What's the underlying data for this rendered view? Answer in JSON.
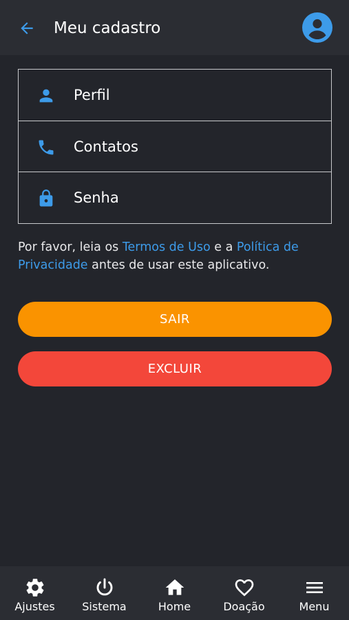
{
  "header": {
    "title": "Meu cadastro",
    "back_icon": "arrow-left-icon",
    "avatar_icon": "account-circle-icon"
  },
  "menu": {
    "items": [
      {
        "label": "Perfil",
        "icon": "person-icon"
      },
      {
        "label": "Contatos",
        "icon": "phone-icon"
      },
      {
        "label": "Senha",
        "icon": "lock-icon"
      }
    ]
  },
  "notice": {
    "text_before": "Por favor, leia os ",
    "terms_link": "Termos de Uso",
    "text_middle": " e a ",
    "privacy_link": "Política de Privacidade",
    "text_after": " antes de usar este aplicativo."
  },
  "buttons": {
    "sair": "SAIR",
    "excluir": "EXCLUIR"
  },
  "bottom_nav": {
    "items": [
      {
        "label": "Ajustes",
        "icon": "gear-icon"
      },
      {
        "label": "Sistema",
        "icon": "power-icon"
      },
      {
        "label": "Home",
        "icon": "home-icon"
      },
      {
        "label": "Doação",
        "icon": "heart-icon"
      },
      {
        "label": "Menu",
        "icon": "hamburger-menu-icon"
      }
    ]
  },
  "colors": {
    "background": "#23252b",
    "bar": "#2b2d33",
    "accent_blue": "#3d9be9",
    "sair_button": "#fa9300",
    "excluir_button": "#f3473a"
  }
}
